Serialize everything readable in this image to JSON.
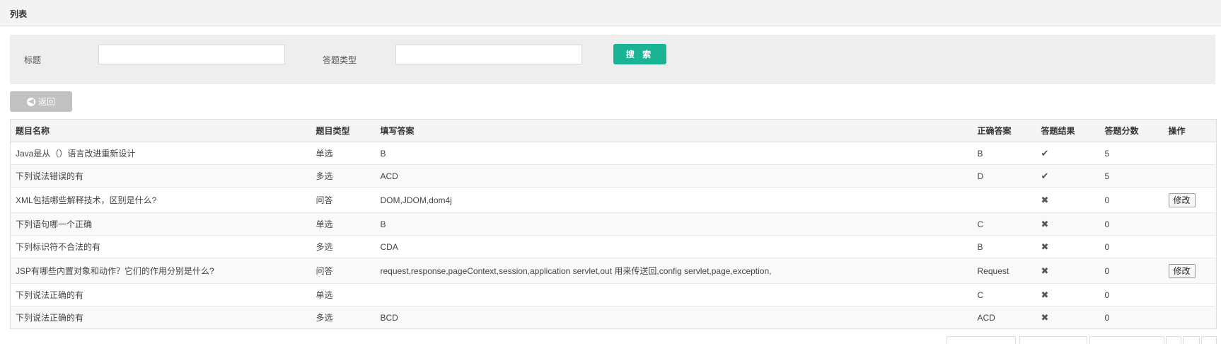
{
  "panel": {
    "title": "列表"
  },
  "search": {
    "title_label": "标题",
    "title_value": "",
    "type_label": "答题类型",
    "type_value": "",
    "search_button": "搜 索"
  },
  "back_button": "返回",
  "table": {
    "headers": [
      "题目名称",
      "题目类型",
      "填写答案",
      "正确答案",
      "答题结果",
      "答题分数",
      "操作"
    ],
    "rows": [
      {
        "name": "Java是从（）语言改进重新设计",
        "type": "单选",
        "answer": "B",
        "correct": "B",
        "result": "✔",
        "score": "5",
        "action": ""
      },
      {
        "name": "下列说法错误的有",
        "type": "多选",
        "answer": "ACD",
        "correct": "D",
        "result": "✔",
        "score": "5",
        "action": ""
      },
      {
        "name": "XML包括哪些解释技术，区别是什么?",
        "type": "问答",
        "answer": "DOM,JDOM,dom4j",
        "correct": "",
        "result": "✖",
        "score": "0",
        "action": "修改"
      },
      {
        "name": "下列语句哪一个正确",
        "type": "单选",
        "answer": "B",
        "correct": "C",
        "result": "✖",
        "score": "0",
        "action": ""
      },
      {
        "name": "下列标识符不合法的有",
        "type": "多选",
        "answer": "CDA",
        "correct": "B",
        "result": "✖",
        "score": "0",
        "action": ""
      },
      {
        "name": "JSP有哪些内置对象和动作？它们的作用分别是什么?",
        "type": "问答",
        "answer": "request,response,pageContext,session,application servlet,out 用来传送回,config servlet,page,exception,",
        "correct": "Request",
        "result": "✖",
        "score": "0",
        "action": "修改"
      },
      {
        "name": "下列说法正确的有",
        "type": "单选",
        "answer": "",
        "correct": "C",
        "result": "✖",
        "score": "0",
        "action": ""
      },
      {
        "name": "下列说法正确的有",
        "type": "多选",
        "answer": "BCD",
        "correct": "ACD",
        "result": "✖",
        "score": "0",
        "action": ""
      }
    ]
  }
}
